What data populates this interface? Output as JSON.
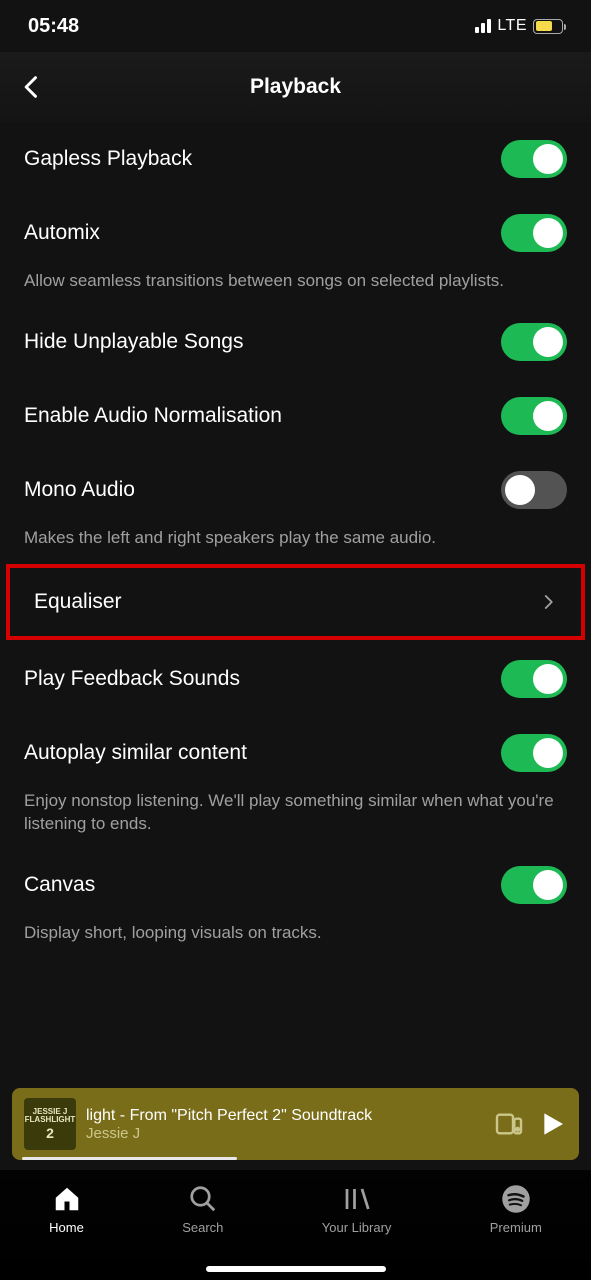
{
  "status": {
    "time": "05:48",
    "network": "LTE"
  },
  "header": {
    "title": "Playback"
  },
  "settings": {
    "gapless": {
      "label": "Gapless Playback",
      "on": true
    },
    "automix": {
      "label": "Automix",
      "on": true,
      "desc": "Allow seamless transitions between songs on selected playlists."
    },
    "hide_unplayable": {
      "label": "Hide Unplayable Songs",
      "on": true
    },
    "normalisation": {
      "label": "Enable Audio Normalisation",
      "on": true
    },
    "mono": {
      "label": "Mono Audio",
      "on": false,
      "desc": "Makes the left and right speakers play the same audio."
    },
    "equaliser": {
      "label": "Equaliser"
    },
    "feedback_sounds": {
      "label": "Play Feedback Sounds",
      "on": true
    },
    "autoplay": {
      "label": "Autoplay similar content",
      "on": true,
      "desc": "Enjoy nonstop listening. We'll play something similar when what you're listening to ends."
    },
    "canvas": {
      "label": "Canvas",
      "on": true,
      "desc": "Display short, looping visuals on tracks."
    }
  },
  "now_playing": {
    "title": "light - From \"Pitch Perfect 2\" Soundtrack",
    "artist": "Jessie J",
    "album_line1": "JESSIE J",
    "album_line2": "FLASHLIGHT",
    "album_line3": "2"
  },
  "nav": {
    "home": "Home",
    "search": "Search",
    "library": "Your Library",
    "premium": "Premium"
  }
}
